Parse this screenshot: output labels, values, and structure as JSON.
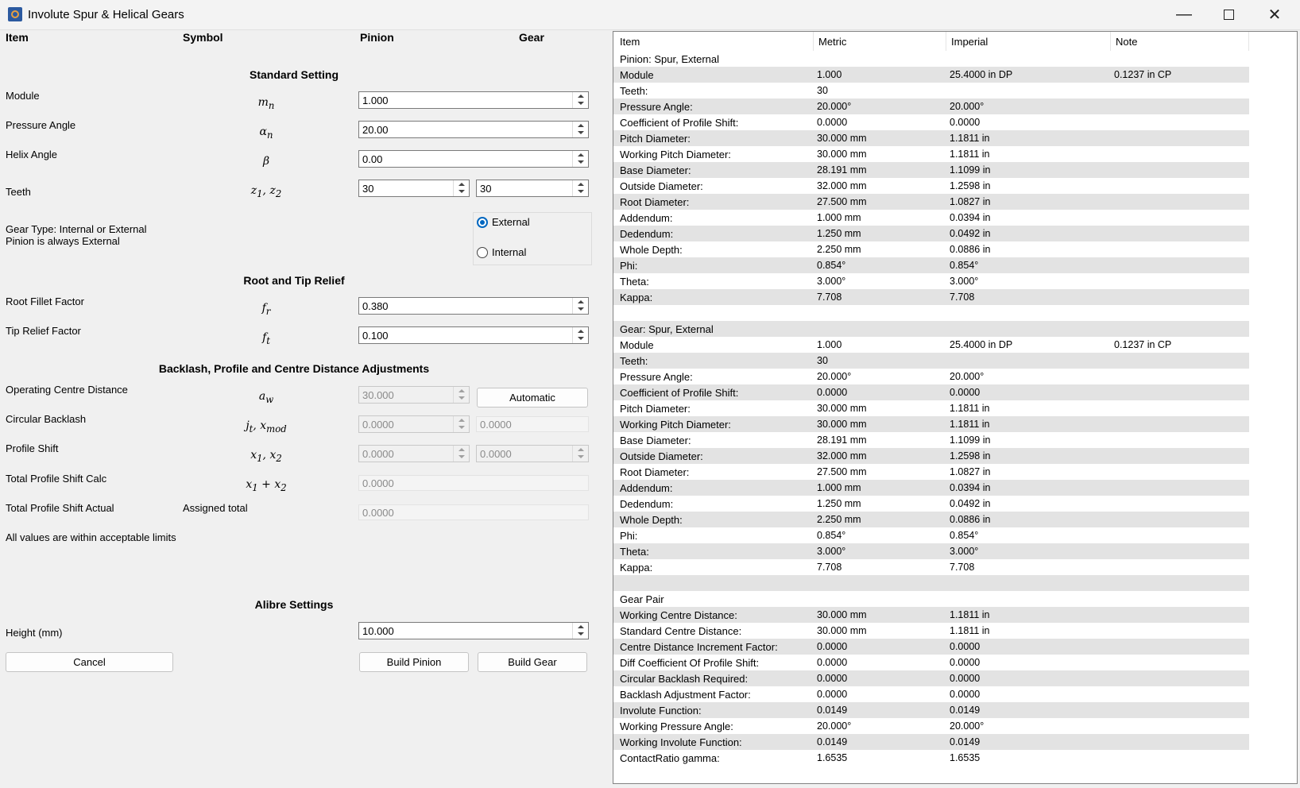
{
  "window": {
    "title": "Involute Spur & Helical Gears"
  },
  "form": {
    "headers": {
      "item": "Item",
      "symbol": "Symbol",
      "pinion": "Pinion",
      "gear": "Gear"
    },
    "sections": {
      "standard": "Standard Setting",
      "relief": "Root and Tip Relief",
      "backlash": "Backlash, Profile and Centre Distance Adjustments",
      "alibre": "Alibre Settings"
    },
    "module": {
      "label": "Module",
      "value": "1.000"
    },
    "pressure_angle": {
      "label": "Pressure Angle",
      "value": "20.00"
    },
    "helix_angle": {
      "label": "Helix Angle",
      "value": "0.00"
    },
    "teeth": {
      "label": "Teeth",
      "pinion": "30",
      "gear": "30"
    },
    "gear_type": {
      "label1": "Gear Type: Internal or External",
      "label2": "Pinion is always External",
      "external": "External",
      "internal": "Internal",
      "selected": "External"
    },
    "root_fillet": {
      "label": "Root Fillet Factor",
      "value": "0.380"
    },
    "tip_relief": {
      "label": "Tip Relief Factor",
      "value": "0.100"
    },
    "centre_distance": {
      "label": "Operating Centre Distance",
      "value": "30.000",
      "button": "Automatic"
    },
    "circular_backlash": {
      "label": "Circular Backlash",
      "value1": "0.0000",
      "value2": "0.0000"
    },
    "profile_shift": {
      "label": "Profile Shift",
      "pinion": "0.0000",
      "gear": "0.0000"
    },
    "total_shift_calc": {
      "label": "Total Profile Shift Calc",
      "value": "0.0000"
    },
    "total_shift_actual": {
      "label": "Total Profile Shift Actual",
      "note": "Assigned total",
      "value": "0.0000"
    },
    "status": "All values are within acceptable limits",
    "height": {
      "label": "Height (mm)",
      "value": "10.000"
    },
    "buttons": {
      "cancel": "Cancel",
      "build_pinion": "Build Pinion",
      "build_gear": "Build Gear"
    }
  },
  "results": {
    "columns": [
      "Item",
      "Metric",
      "Imperial",
      "Note"
    ],
    "rows": [
      [
        "Pinion: Spur, External",
        "",
        "",
        ""
      ],
      [
        "Module",
        "1.000",
        "25.4000 in DP",
        "0.1237 in CP"
      ],
      [
        "Teeth:",
        "30",
        "",
        ""
      ],
      [
        "Pressure Angle:",
        "20.000°",
        "20.000°",
        ""
      ],
      [
        "Coefficient of Profile Shift:",
        "0.0000",
        "0.0000",
        ""
      ],
      [
        "Pitch Diameter:",
        "30.000 mm",
        "1.1811 in",
        ""
      ],
      [
        "Working Pitch Diameter:",
        "30.000 mm",
        "1.1811 in",
        ""
      ],
      [
        "Base Diameter:",
        "28.191 mm",
        "1.1099 in",
        ""
      ],
      [
        "Outside Diameter:",
        "32.000 mm",
        "1.2598 in",
        ""
      ],
      [
        "Root Diameter:",
        "27.500 mm",
        "1.0827 in",
        ""
      ],
      [
        "Addendum:",
        "1.000 mm",
        "0.0394 in",
        ""
      ],
      [
        "Dedendum:",
        "1.250 mm",
        "0.0492 in",
        ""
      ],
      [
        "Whole Depth:",
        "2.250 mm",
        "0.0886 in",
        ""
      ],
      [
        "Phi:",
        "0.854°",
        "0.854°",
        ""
      ],
      [
        "Theta:",
        "3.000°",
        "3.000°",
        ""
      ],
      [
        "Kappa:",
        "7.708",
        "7.708",
        ""
      ],
      [
        "",
        "",
        "",
        ""
      ],
      [
        "Gear: Spur, External",
        "",
        "",
        ""
      ],
      [
        "Module",
        "1.000",
        "25.4000 in DP",
        "0.1237 in CP"
      ],
      [
        "Teeth:",
        "30",
        "",
        ""
      ],
      [
        "Pressure Angle:",
        "20.000°",
        "20.000°",
        ""
      ],
      [
        "Coefficient of Profile Shift:",
        "0.0000",
        "0.0000",
        ""
      ],
      [
        "Pitch Diameter:",
        "30.000 mm",
        "1.1811 in",
        ""
      ],
      [
        "Working Pitch Diameter:",
        "30.000 mm",
        "1.1811 in",
        ""
      ],
      [
        "Base Diameter:",
        "28.191 mm",
        "1.1099 in",
        ""
      ],
      [
        "Outside Diameter:",
        "32.000 mm",
        "1.2598 in",
        ""
      ],
      [
        "Root Diameter:",
        "27.500 mm",
        "1.0827 in",
        ""
      ],
      [
        "Addendum:",
        "1.000 mm",
        "0.0394 in",
        ""
      ],
      [
        "Dedendum:",
        "1.250 mm",
        "0.0492 in",
        ""
      ],
      [
        "Whole Depth:",
        "2.250 mm",
        "0.0886 in",
        ""
      ],
      [
        "Phi:",
        "0.854°",
        "0.854°",
        ""
      ],
      [
        "Theta:",
        "3.000°",
        "3.000°",
        ""
      ],
      [
        "Kappa:",
        "7.708",
        "7.708",
        ""
      ],
      [
        "",
        "",
        "",
        ""
      ],
      [
        "Gear Pair",
        "",
        "",
        ""
      ],
      [
        "Working Centre Distance:",
        "30.000 mm",
        "1.1811 in",
        ""
      ],
      [
        "Standard Centre Distance:",
        "30.000 mm",
        "1.1811 in",
        ""
      ],
      [
        "Centre Distance Increment Factor:",
        "0.0000",
        "0.0000",
        ""
      ],
      [
        "Diff Coefficient Of Profile Shift:",
        "0.0000",
        "0.0000",
        ""
      ],
      [
        "Circular Backlash Required:",
        "0.0000",
        "0.0000",
        ""
      ],
      [
        "Backlash Adjustment Factor:",
        "0.0000",
        "0.0000",
        ""
      ],
      [
        "Involute Function:",
        "0.0149",
        "0.0149",
        ""
      ],
      [
        "Working Pressure Angle:",
        "20.000°",
        "20.000°",
        ""
      ],
      [
        "Working Involute Function:",
        "0.0149",
        "0.0149",
        ""
      ],
      [
        "ContactRatio gamma:",
        "1.6535",
        "1.6535",
        ""
      ]
    ]
  }
}
